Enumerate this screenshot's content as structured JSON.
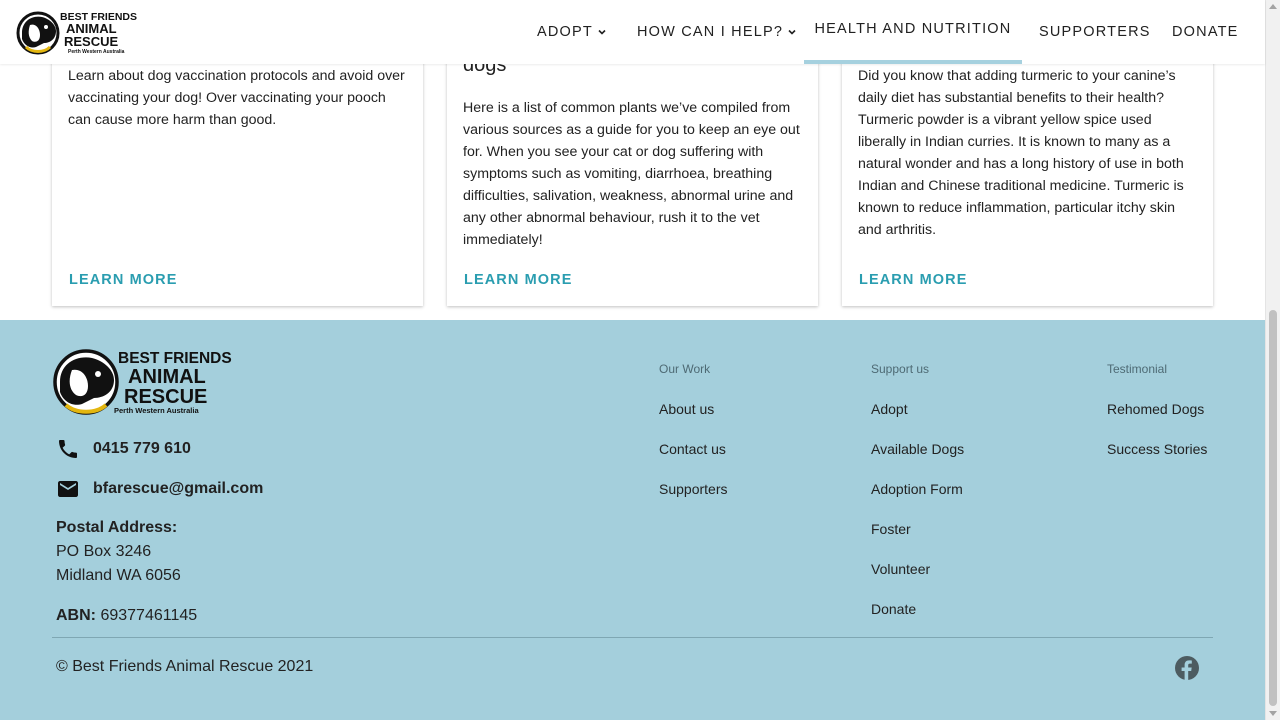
{
  "header": {
    "logo": {
      "line1": "BEST FRIENDS",
      "line2": "ANIMAL",
      "line3": "RESCUE",
      "line4": "Perth Western Australia"
    },
    "nav": [
      {
        "label": "ADOPT",
        "has_dropdown": true
      },
      {
        "label": "HOW CAN I HELP?",
        "has_dropdown": true
      },
      {
        "label": "HEALTH AND NUTRITION",
        "active": true
      },
      {
        "label": "SUPPORTERS"
      },
      {
        "label": "DONATE"
      }
    ]
  },
  "cards": [
    {
      "title": "",
      "text": "Learn about dog vaccination protocols and avoid over vaccinating your dog! Over vaccinating your pooch can cause more harm than good.",
      "cta": "LEARN MORE"
    },
    {
      "title": "dogs",
      "text": "Here is a list of common plants we’ve compiled from various sources as a guide for you to keep an eye out for. When you see your cat or dog suffering with symptoms such as vomiting, diarrhoea, breathing difficulties, salivation, weakness, abnormal urine and any other abnormal behaviour, rush it to the vet immediately!",
      "cta": "LEARN MORE"
    },
    {
      "title": "",
      "text": "Did you know that adding turmeric to your canine’s daily diet has substantial benefits to their health? Turmeric powder is a vibrant yellow spice used liberally in Indian curries. It is known to many as a natural wonder and has a long history of use in both Indian and Chinese traditional medicine. Turmeric is known to reduce inflammation, particular itchy skin and arthritis.",
      "cta": "LEARN MORE"
    }
  ],
  "footer": {
    "logo": {
      "line1": "BEST FRIENDS",
      "line2": "ANIMAL",
      "line3": "RESCUE",
      "line4": "Perth Western Australia"
    },
    "phone": "0415 779 610",
    "email": "bfarescue@gmail.com",
    "postal_label": "Postal Address:",
    "postal_line1": "PO Box 3246",
    "postal_line2": "Midland WA 6056",
    "abn_label": "ABN:",
    "abn_value": "69377461145",
    "columns": [
      {
        "heading": "Our Work",
        "links": [
          "About us",
          "Contact us",
          "Supporters"
        ]
      },
      {
        "heading": "Support us",
        "links": [
          "Adopt",
          "Available Dogs",
          "Adoption Form",
          "Foster",
          "Volunteer",
          "Donate"
        ]
      },
      {
        "heading": "Testimonial",
        "links": [
          "Rehomed Dogs",
          "Success Stories"
        ]
      }
    ],
    "copyright": "© Best Friends Animal Rescue 2021",
    "social_icon": "facebook-icon"
  },
  "colors": {
    "accent": "#2a9db0",
    "footer_bg": "#a4cfdc",
    "active_nav_underline": "#a6d1df"
  }
}
